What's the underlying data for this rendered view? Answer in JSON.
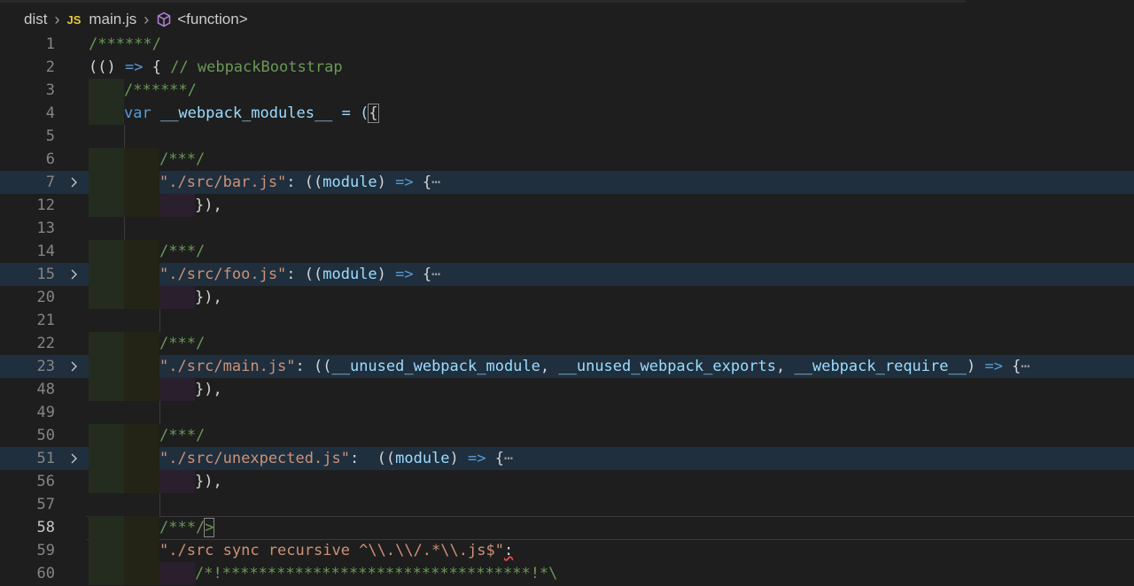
{
  "breadcrumb": {
    "folder": "dist",
    "file_badge": "JS",
    "file": "main.js",
    "symbol": "<function>"
  },
  "lines": [
    {
      "n": "1"
    },
    {
      "n": "2"
    },
    {
      "n": "3"
    },
    {
      "n": "4"
    },
    {
      "n": "5"
    },
    {
      "n": "6"
    },
    {
      "n": "7"
    },
    {
      "n": "12"
    },
    {
      "n": "13"
    },
    {
      "n": "14"
    },
    {
      "n": "15"
    },
    {
      "n": "20"
    },
    {
      "n": "21"
    },
    {
      "n": "22"
    },
    {
      "n": "23"
    },
    {
      "n": "48"
    },
    {
      "n": "49"
    },
    {
      "n": "50"
    },
    {
      "n": "51"
    },
    {
      "n": "56"
    },
    {
      "n": "57"
    },
    {
      "n": "58"
    },
    {
      "n": "59"
    },
    {
      "n": "60"
    }
  ],
  "code": {
    "l1": "/******/",
    "l2_a": "(() ",
    "l2_b": "=>",
    "l2_c": " { ",
    "l2_d": "// webpackBootstrap",
    "l3": "/******/",
    "l4_a": "var",
    "l4_b": " __webpack_modules__ = (",
    "l4_c": "{",
    "l6": "/***/",
    "l7_a": "\"./src/bar.js\"",
    "l7_b": ": ((",
    "l7_c": "module",
    "l7_d": ") ",
    "l7_e": "=>",
    "l7_f": " {",
    "l7_g": "⋯",
    "l12": "}),",
    "l14": "/***/",
    "l15_a": "\"./src/foo.js\"",
    "l15_b": ": ((",
    "l15_c": "module",
    "l15_d": ") ",
    "l15_e": "=>",
    "l15_f": " {",
    "l15_g": "⋯",
    "l20": "}),",
    "l22": "/***/",
    "l23_a": "\"./src/main.js\"",
    "l23_b": ": ((",
    "l23_c": "__unused_webpack_module",
    "l23_d": ", ",
    "l23_e": "__unused_webpack_exports",
    "l23_f": ", ",
    "l23_g": "__webpack_require__",
    "l23_h": ") ",
    "l23_i": "=>",
    "l23_j": " {",
    "l23_k": "⋯",
    "l48": "}),",
    "l50": "/***/",
    "l51_a": "\"./src/unexpected.js\"",
    "l51_b": ":  ((",
    "l51_c": "module",
    "l51_d": ") ",
    "l51_e": "=>",
    "l51_f": " {",
    "l51_g": "⋯",
    "l56": "}),",
    "l58_a": "/***/",
    "l58_b": ">",
    "l59_a": "\"./src sync recursive ^\\\\.\\\\/.*\\\\.js$\"",
    "l59_b": ":",
    "l60": "/*!**********************************!*\\"
  },
  "colors": {
    "background": "#1e1e1e",
    "comment": "#6a9955",
    "string": "#ce9178",
    "keyword": "#569cd6",
    "variable": "#9cdcfe",
    "folded_line_bg": "#1f2f3d"
  }
}
